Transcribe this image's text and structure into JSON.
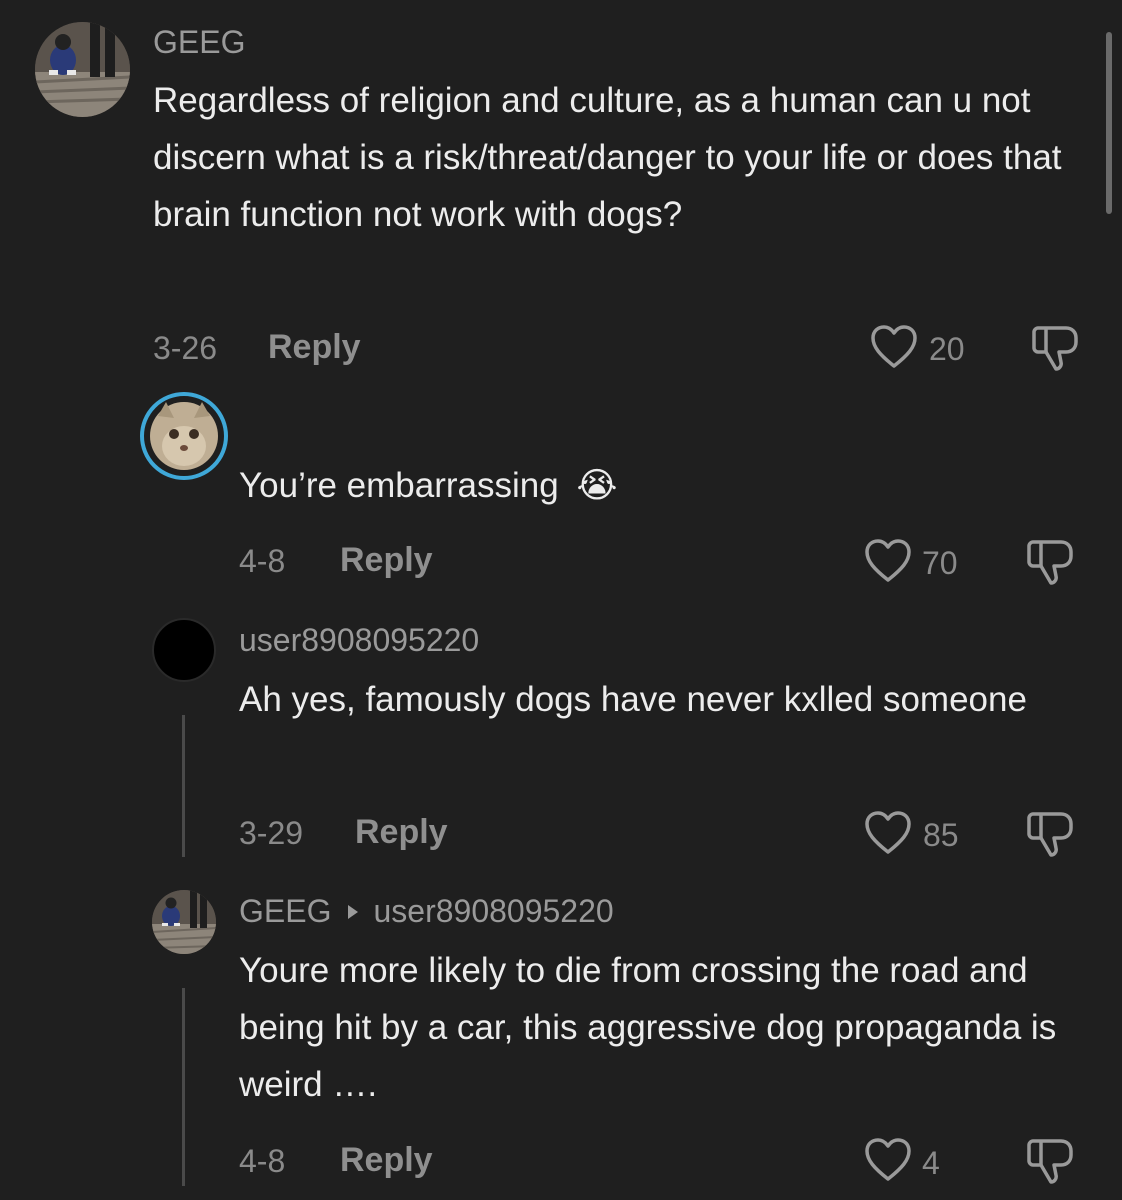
{
  "comments": [
    {
      "username": "GEEG",
      "text": "Regardless of religion and culture, as a human can u not discern what is a risk/threat/danger to your life or does that brain function not work with dogs?",
      "date": "3-26",
      "reply_label": "Reply",
      "likes": "20"
    },
    {
      "username": "",
      "text": "You’re embarrassing",
      "emoji": "😭",
      "date": "4-8",
      "reply_label": "Reply",
      "likes": "70"
    },
    {
      "username": "user8908095220",
      "text": "Ah yes, famously dogs have never kxlled someone",
      "date": "3-29",
      "reply_label": "Reply",
      "likes": "85"
    },
    {
      "username": "GEEG",
      "reply_to": "user8908095220",
      "text": "Youre more likely to die from crossing the road and being hit by a car, this aggressive dog propaganda is weird ….",
      "date": "4-8",
      "reply_label": "Reply",
      "likes": "4"
    }
  ],
  "icons": {
    "like": "heart-outline-icon",
    "dislike": "thumbs-down-icon",
    "reply_arrow": "caret-right-icon"
  },
  "colors": {
    "background": "#1f1f1f",
    "text": "#ececec",
    "muted": "#8a8a8a",
    "avatar_ring": "#3fa8d8"
  }
}
